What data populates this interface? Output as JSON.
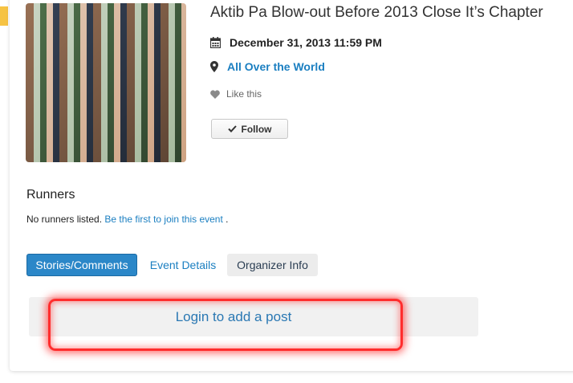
{
  "event": {
    "title": "Aktib Pa Blow-out Before 2013 Close It’s Chapter",
    "date": "December 31, 2013 11:59 PM",
    "location": "All Over the World",
    "like_label": "Like this",
    "follow_label": "Follow"
  },
  "runners": {
    "heading": "Runners",
    "empty_text": "No runners listed.",
    "join_link": "Be the first to join this event",
    "period": "."
  },
  "tabs": [
    {
      "label": "Stories/Comments",
      "active": true
    },
    {
      "label": "Event Details",
      "active": false
    },
    {
      "label": "Organizer Info",
      "active": false
    }
  ],
  "login_prompt": "Login to add a post",
  "icons": {
    "date": "calendar-icon",
    "location": "map-marker-icon",
    "like": "heart-icon",
    "follow": "check-icon"
  },
  "colors": {
    "link": "#1b7fc1",
    "active_tab": "#2b87c8",
    "highlight": "#ff2d2d"
  }
}
